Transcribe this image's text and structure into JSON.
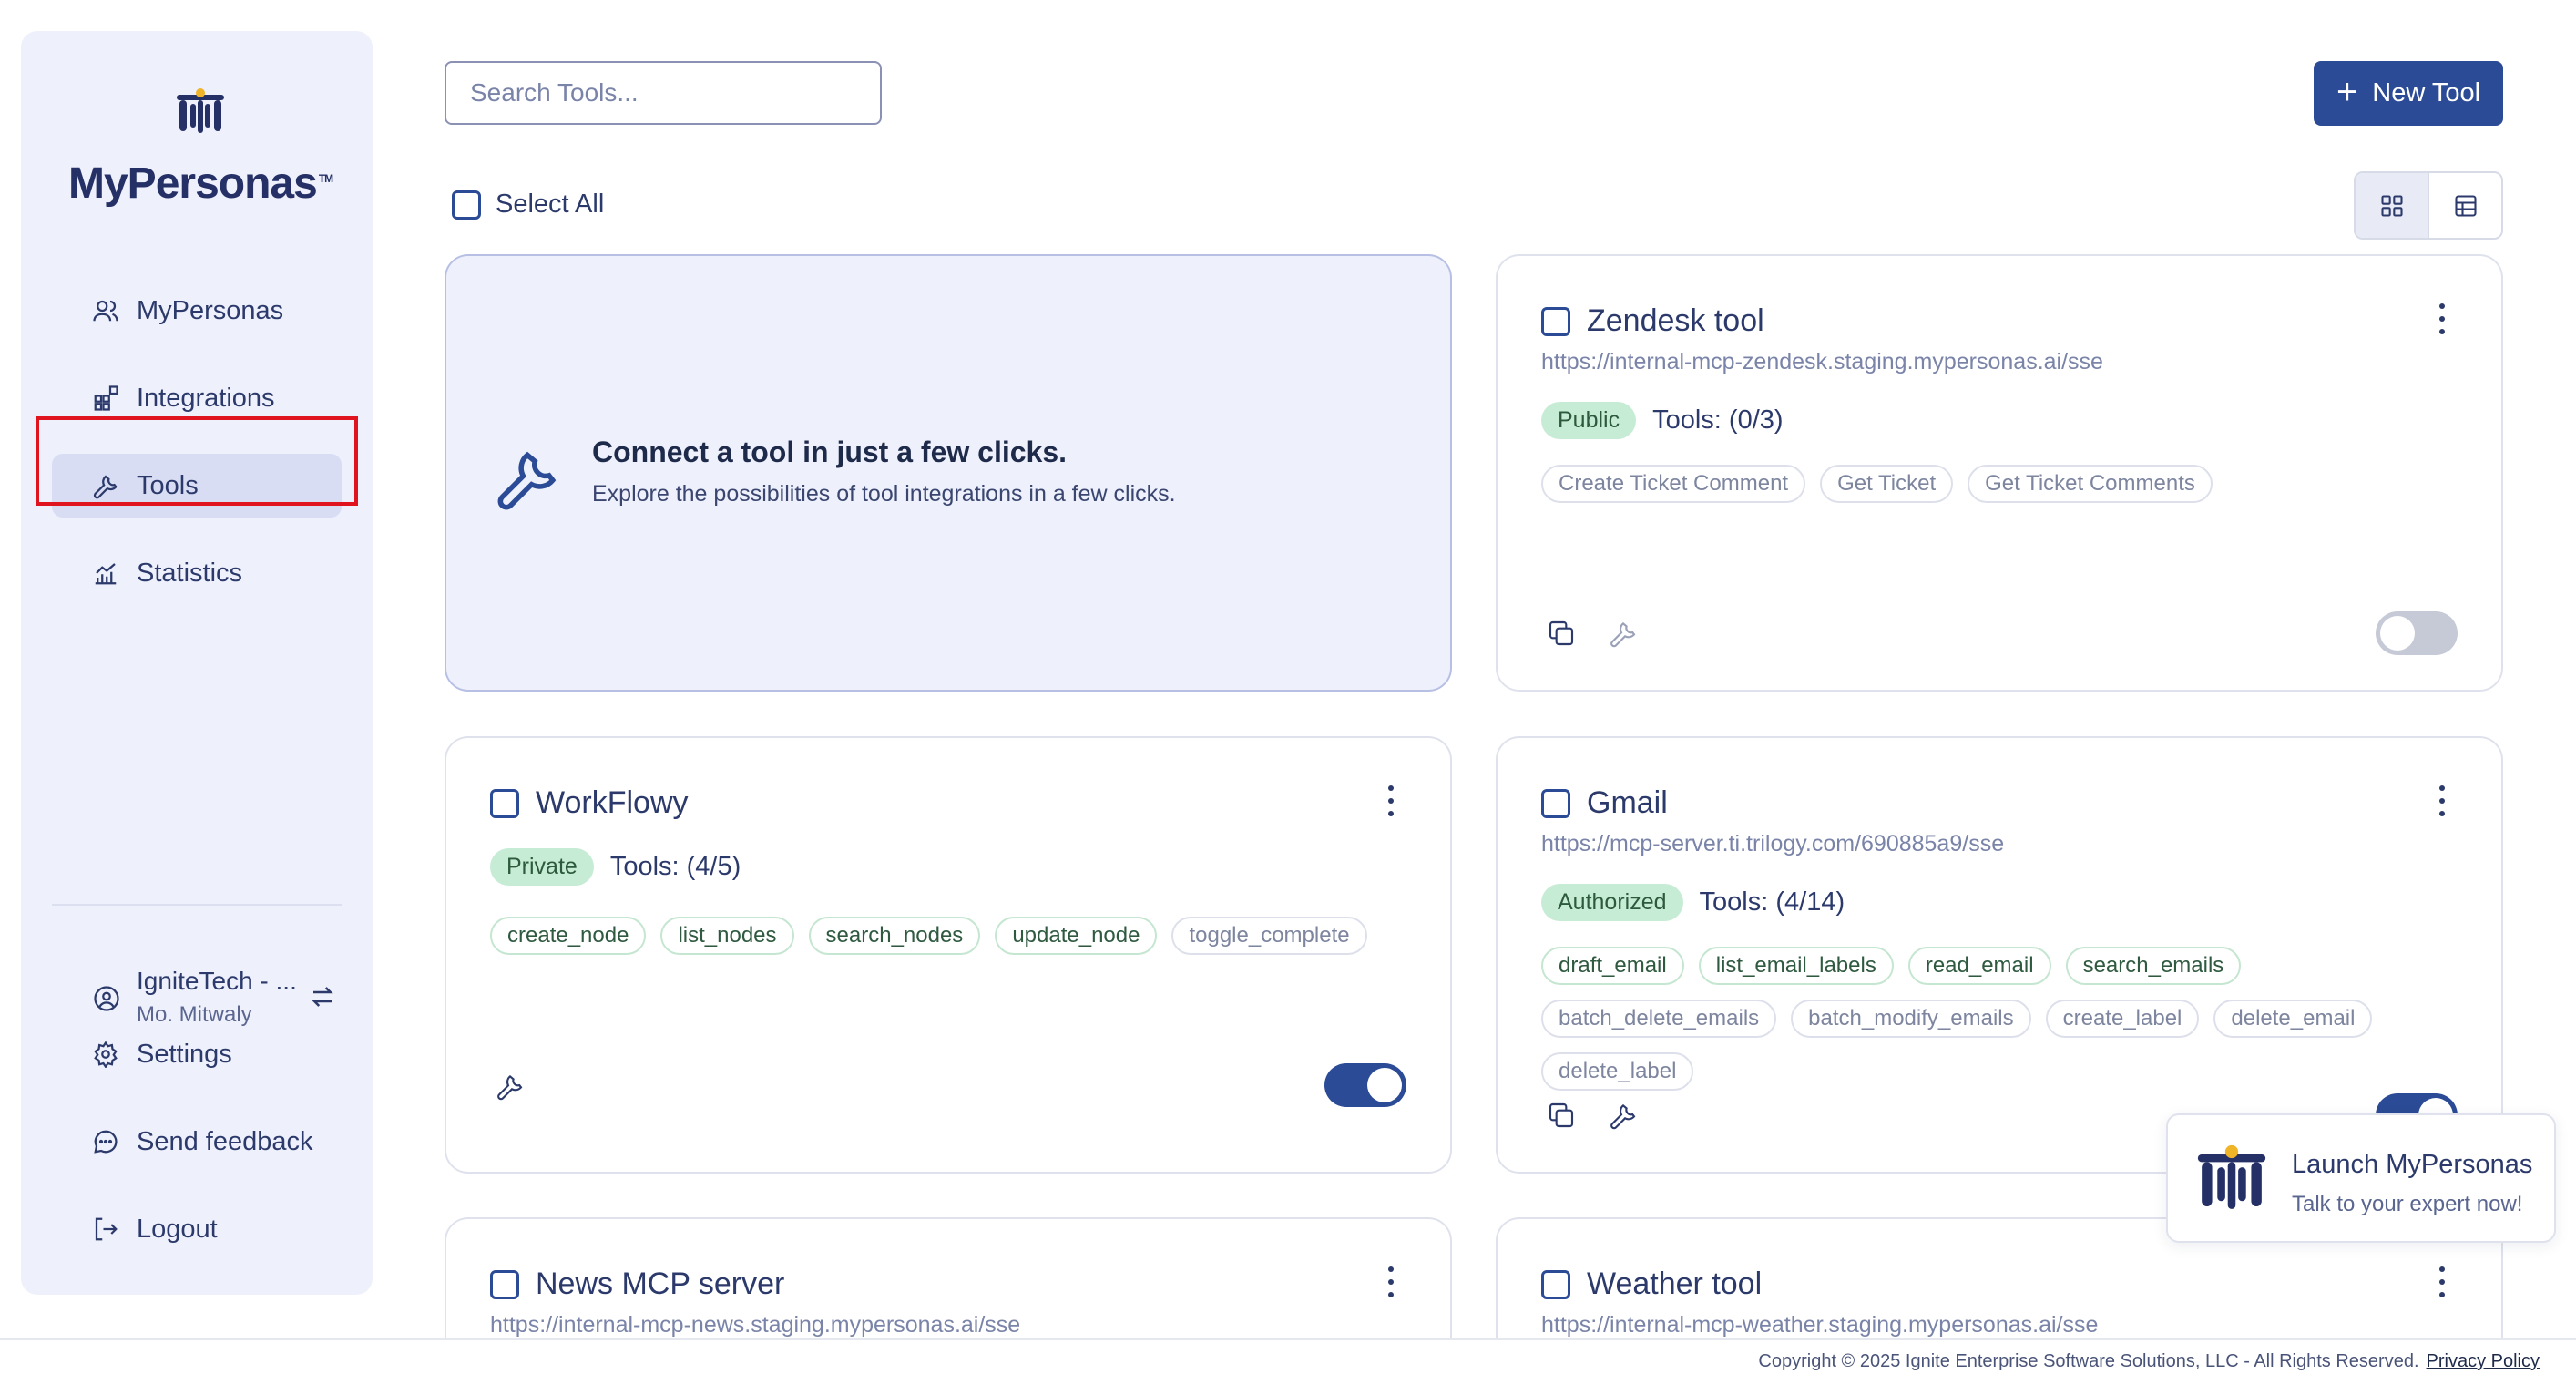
{
  "brand": {
    "name_pre": "MyPers",
    "name_o": "o",
    "name_post": "nas",
    "tm": "TM",
    "accent": "#2b4b96"
  },
  "sidebar": {
    "items": [
      {
        "label": "MyPersonas",
        "icon": "users-icon"
      },
      {
        "label": "Integrations",
        "icon": "integrations-icon"
      },
      {
        "label": "Tools",
        "icon": "wrench-icon",
        "active": true
      },
      {
        "label": "Statistics",
        "icon": "chart-icon"
      }
    ],
    "org": {
      "name": "IgniteTech - ...",
      "user": "Mo. Mitwaly"
    },
    "bottom": [
      {
        "label": "Settings",
        "icon": "gear-icon"
      },
      {
        "label": "Send feedback",
        "icon": "chat-icon"
      },
      {
        "label": "Logout",
        "icon": "logout-icon"
      }
    ]
  },
  "toolbar": {
    "search_placeholder": "Search Tools...",
    "new_button": "New Tool",
    "select_all": "Select All"
  },
  "promo": {
    "title": "Connect a tool in just a few clicks.",
    "subtitle": "Explore the possibilities of tool integrations in a few clicks."
  },
  "cards": [
    {
      "title": "Zendesk tool",
      "url": "https://internal-mcp-zendesk.staging.mypersonas.ai/sse",
      "badge": "Public",
      "tools": "Tools: (0/3)",
      "chips": [
        "Create Ticket Comment",
        "Get Ticket",
        "Get Ticket Comments"
      ],
      "enabled": false
    },
    {
      "title": "WorkFlowy",
      "url": "",
      "badge": "Private",
      "tools": "Tools: (4/5)",
      "chips": [
        "create_node",
        "list_nodes",
        "search_nodes",
        "update_node",
        "toggle_complete"
      ],
      "enabled": true
    },
    {
      "title": "Gmail",
      "url": "https://mcp-server.ti.trilogy.com/690885a9/sse",
      "badge": "Authorized",
      "tools": "Tools: (4/14)",
      "chips": [
        "draft_email",
        "list_email_labels",
        "read_email",
        "search_emails",
        "batch_delete_emails",
        "batch_modify_emails",
        "create_label",
        "delete_email",
        "delete_label"
      ],
      "enabled": true
    },
    {
      "title": "News MCP server",
      "url": "https://internal-mcp-news.staging.mypersonas.ai/sse"
    },
    {
      "title": "Weather tool",
      "url": "https://internal-mcp-weather.staging.mypersonas.ai/sse"
    }
  ],
  "launch": {
    "title": "Launch MyPersonas",
    "subtitle": "Talk to your expert now!"
  },
  "footer": {
    "copyright": "Copyright © 2025 Ignite Enterprise Software Solutions, LLC - All Rights Reserved.",
    "privacy": "Privacy Policy"
  }
}
